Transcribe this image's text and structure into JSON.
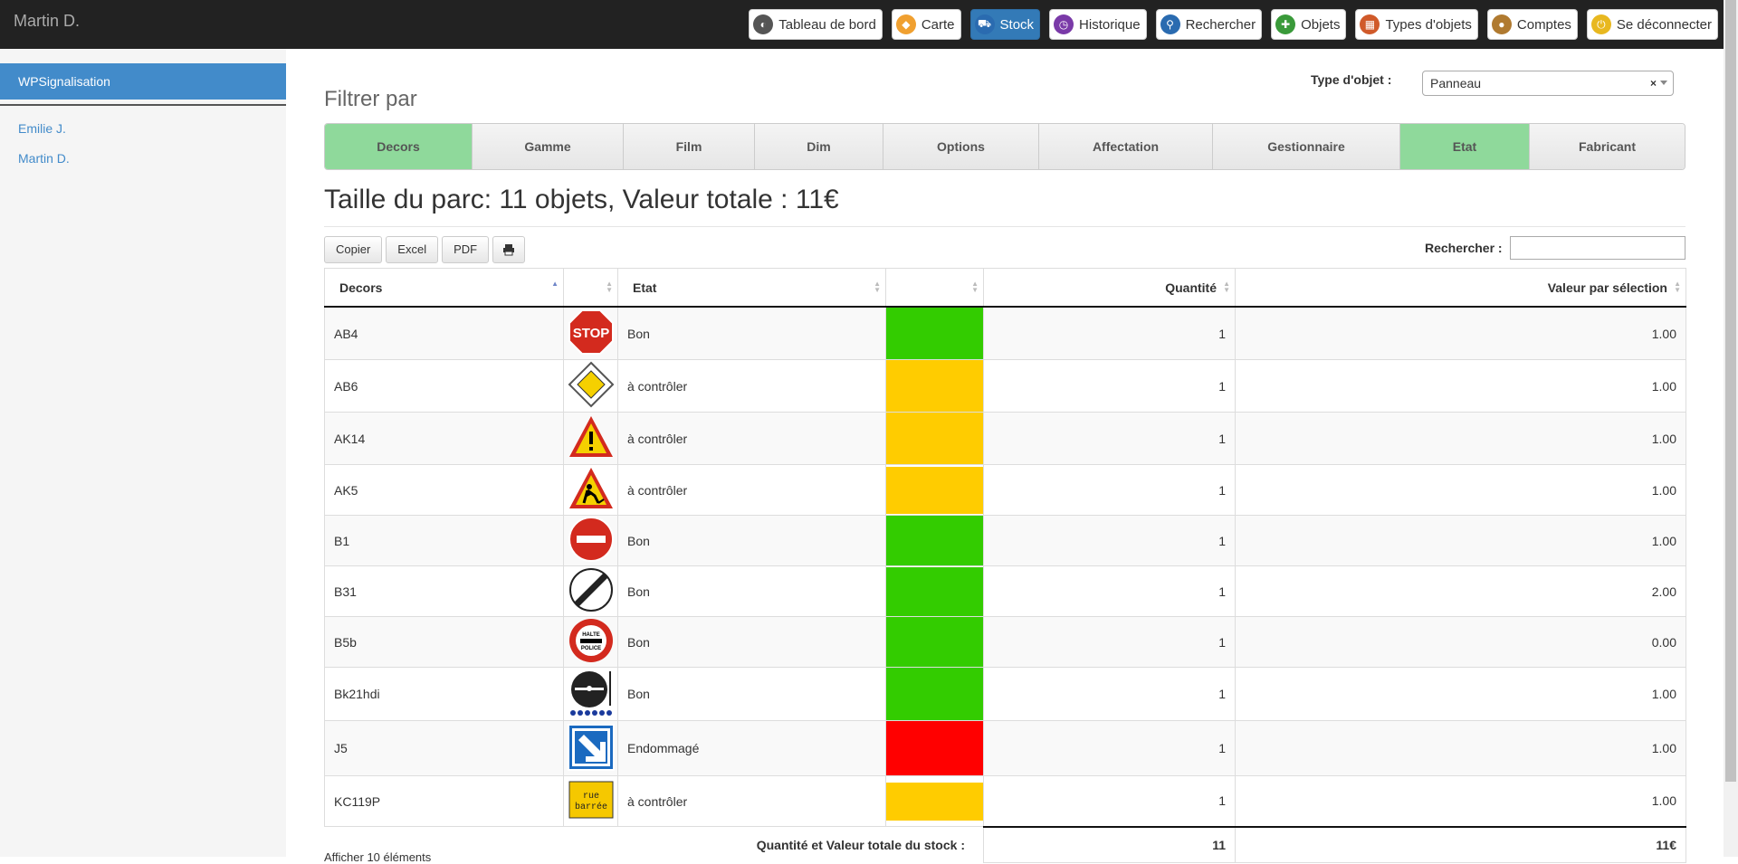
{
  "user": "Martin D.",
  "nav": [
    {
      "label": "Tableau de bord",
      "icon": "dashboard-icon",
      "color": "#555",
      "active": false
    },
    {
      "label": "Carte",
      "icon": "map-icon",
      "color": "#f0a030",
      "active": false
    },
    {
      "label": "Stock",
      "icon": "cart-icon",
      "color": "#2a6bb0",
      "active": true
    },
    {
      "label": "Historique",
      "icon": "history-icon",
      "color": "#7a3aa8",
      "active": false
    },
    {
      "label": "Rechercher",
      "icon": "search-icon",
      "color": "#2a6bb0",
      "active": false
    },
    {
      "label": "Objets",
      "icon": "add-object-icon",
      "color": "#3a9a3a",
      "active": false
    },
    {
      "label": "Types d'objets",
      "icon": "types-icon",
      "color": "#d05a2a",
      "active": false
    },
    {
      "label": "Comptes",
      "icon": "user-icon",
      "color": "#b07a30",
      "active": false
    },
    {
      "label": "Se déconnecter",
      "icon": "power-icon",
      "color": "#e8b820",
      "active": false
    }
  ],
  "sidebar": {
    "active": "WPSignalisation",
    "links": [
      "Emilie J.",
      "Martin D."
    ]
  },
  "filter": {
    "title": "Filtrer par",
    "type_label": "Type d'objet :",
    "type_value": "Panneau",
    "clear": "×"
  },
  "tabs": [
    {
      "label": "Decors",
      "selected": true
    },
    {
      "label": "Gamme",
      "selected": false
    },
    {
      "label": "Film",
      "selected": false
    },
    {
      "label": "Dim",
      "selected": false
    },
    {
      "label": "Options",
      "selected": false
    },
    {
      "label": "Affectation",
      "selected": false
    },
    {
      "label": "Gestionnaire",
      "selected": false
    },
    {
      "label": "Etat",
      "selected": true
    },
    {
      "label": "Fabricant",
      "selected": false
    }
  ],
  "heading": "Taille du parc: 11 objets, Valeur totale : 11€",
  "tools": {
    "copy": "Copier",
    "excel": "Excel",
    "pdf": "PDF",
    "print_icon": "print-icon"
  },
  "search": {
    "label": "Rechercher :",
    "value": ""
  },
  "table": {
    "headers": {
      "decors": "Decors",
      "etat": "Etat",
      "quantite": "Quantité",
      "valeur": "Valeur par sélection"
    },
    "rows": [
      {
        "decor": "AB4",
        "sign": "stop-sign-icon",
        "etat": "Bon",
        "color": "#33cc00",
        "qty": "1",
        "valeur": "1.00"
      },
      {
        "decor": "AB6",
        "sign": "priority-road-sign-icon",
        "etat": "à contrôler",
        "color": "#ffcc00",
        "qty": "1",
        "valeur": "1.00"
      },
      {
        "decor": "AK14",
        "sign": "warning-sign-icon",
        "etat": "à contrôler",
        "color": "#ffcc00",
        "qty": "1",
        "valeur": "1.00"
      },
      {
        "decor": "AK5",
        "sign": "roadworks-sign-icon",
        "etat": "à contrôler",
        "color": "#ffcc00",
        "qty": "1",
        "valeur": "1.00"
      },
      {
        "decor": "B1",
        "sign": "no-entry-sign-icon",
        "etat": "Bon",
        "color": "#33cc00",
        "qty": "1",
        "valeur": "1.00"
      },
      {
        "decor": "B31",
        "sign": "end-restriction-sign-icon",
        "etat": "Bon",
        "color": "#33cc00",
        "qty": "1",
        "valeur": "2.00"
      },
      {
        "decor": "B5b",
        "sign": "halte-police-sign-icon",
        "etat": "Bon",
        "color": "#33cc00",
        "qty": "1",
        "valeur": "0.00"
      },
      {
        "decor": "Bk21hdi",
        "sign": "bk21-sign-icon",
        "etat": "Bon",
        "color": "#33cc00",
        "qty": "1",
        "valeur": "1.00"
      },
      {
        "decor": "J5",
        "sign": "direction-arrow-sign-icon",
        "etat": "Endommagé",
        "color": "#ff0000",
        "qty": "1",
        "valeur": "1.00"
      },
      {
        "decor": "KC119P",
        "sign": "rue-barree-sign-icon",
        "etat": "à contrôler",
        "color": "#ffcc00",
        "qty": "1",
        "valeur": "1.00"
      }
    ],
    "sign_texts": {
      "stop": "STOP",
      "halte": "HALTE",
      "police": "POLICE",
      "rue": "rue",
      "barree": "barrée"
    },
    "footer": {
      "label": "Quantité et Valeur totale du stock :",
      "total_qty": "11",
      "total_val": "11€"
    }
  },
  "show": "Afficher 10 éléments"
}
